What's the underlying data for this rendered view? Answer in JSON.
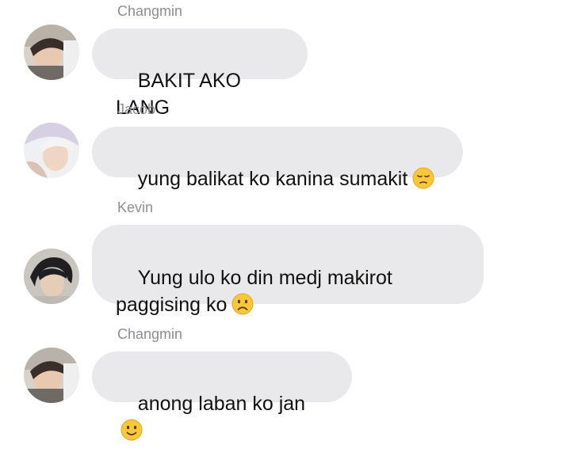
{
  "messages": [
    {
      "sender": "Changmin",
      "text": "BAKIT AKO LANG",
      "emoji": "",
      "avatar": "changmin-avatar"
    },
    {
      "sender": "Jacob",
      "text": "yung balikat ko kanina sumakit",
      "emoji": "pensive-face-icon",
      "avatar": "jacob-avatar"
    },
    {
      "sender": "Kevin",
      "text": "Yung ulo ko din medj makirot\npaggising ko",
      "emoji": "frowning-face-icon",
      "avatar": "kevin-avatar"
    },
    {
      "sender": "Changmin",
      "text": "anong laban ko jan",
      "emoji": "slightly-smiling-face-icon",
      "avatar": "changmin-avatar"
    }
  ],
  "colors": {
    "bubble": "#e9e9eb",
    "sender_name": "#8e8e93",
    "text": "#111111",
    "emoji_face": "#f7c83a"
  }
}
